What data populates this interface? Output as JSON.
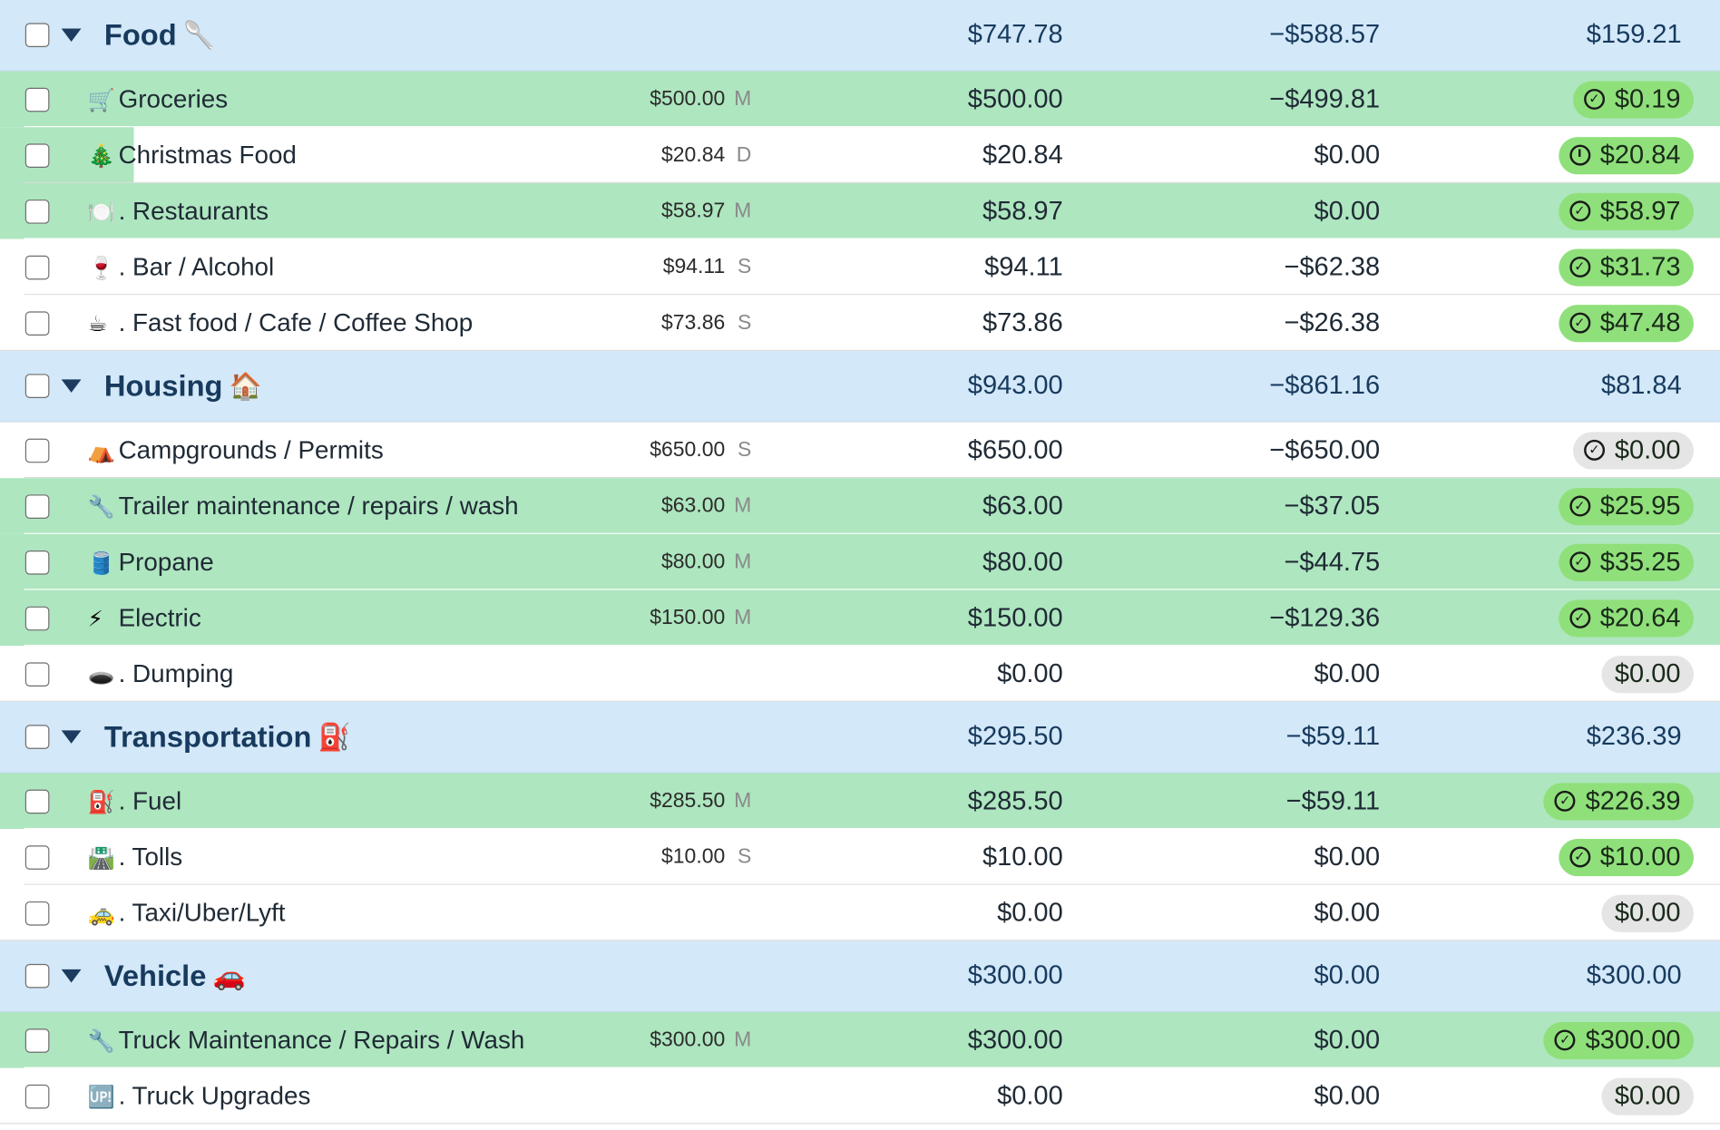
{
  "groups": [
    {
      "name": "Food",
      "emoji": "🥄",
      "assigned": "$747.78",
      "activity": "−$588.57",
      "available": "$159.21",
      "items": [
        {
          "emoji": "🛒",
          "name": "Groceries",
          "target": "$500.00",
          "code": "M",
          "assigned": "$500.00",
          "activity": "−$499.81",
          "available": "$0.19",
          "status": "check",
          "color": "green",
          "row": "funded"
        },
        {
          "emoji": "🎄",
          "name": "Christmas Food",
          "target": "$20.84",
          "code": "D",
          "assigned": "$20.84",
          "activity": "$0.00",
          "available": "$20.84",
          "status": "clock",
          "color": "green",
          "row": "partial"
        },
        {
          "emoji": "🍽️",
          "name": ". Restaurants",
          "target": "$58.97",
          "code": "M",
          "assigned": "$58.97",
          "activity": "$0.00",
          "available": "$58.97",
          "status": "check",
          "color": "green",
          "row": "funded"
        },
        {
          "emoji": "🍷",
          "name": ". Bar / Alcohol",
          "target": "$94.11",
          "code": "S",
          "assigned": "$94.11",
          "activity": "−$62.38",
          "available": "$31.73",
          "status": "check",
          "color": "green",
          "row": "plain"
        },
        {
          "emoji": "☕",
          "name": ". Fast food / Cafe / Coffee Shop",
          "target": "$73.86",
          "code": "S",
          "assigned": "$73.86",
          "activity": "−$26.38",
          "available": "$47.48",
          "status": "check",
          "color": "green",
          "row": "plain"
        }
      ]
    },
    {
      "name": "Housing",
      "emoji": "🏠",
      "assigned": "$943.00",
      "activity": "−$861.16",
      "available": "$81.84",
      "items": [
        {
          "emoji": "⛺",
          "name": "Campgrounds / Permits",
          "target": "$650.00",
          "code": "S",
          "assigned": "$650.00",
          "activity": "−$650.00",
          "available": "$0.00",
          "status": "check",
          "color": "grey",
          "row": "plain"
        },
        {
          "emoji": "🔧",
          "name": "Trailer maintenance / repairs / wash",
          "target": "$63.00",
          "code": "M",
          "assigned": "$63.00",
          "activity": "−$37.05",
          "available": "$25.95",
          "status": "check",
          "color": "green",
          "row": "funded"
        },
        {
          "emoji": "🛢️",
          "name": "Propane",
          "target": "$80.00",
          "code": "M",
          "assigned": "$80.00",
          "activity": "−$44.75",
          "available": "$35.25",
          "status": "check",
          "color": "green",
          "row": "funded"
        },
        {
          "emoji": "⚡",
          "name": "Electric",
          "target": "$150.00",
          "code": "M",
          "assigned": "$150.00",
          "activity": "−$129.36",
          "available": "$20.64",
          "status": "check",
          "color": "green",
          "row": "funded"
        },
        {
          "emoji": "🕳️",
          "name": ". Dumping",
          "target": "",
          "code": "",
          "assigned": "$0.00",
          "activity": "$0.00",
          "available": "$0.00",
          "status": "none",
          "color": "grey",
          "row": "plain"
        }
      ]
    },
    {
      "name": "Transportation",
      "emoji": "⛽",
      "assigned": "$295.50",
      "activity": "−$59.11",
      "available": "$236.39",
      "items": [
        {
          "emoji": "⛽",
          "name": ". Fuel",
          "target": "$285.50",
          "code": "M",
          "assigned": "$285.50",
          "activity": "−$59.11",
          "available": "$226.39",
          "status": "check",
          "color": "green",
          "row": "funded"
        },
        {
          "emoji": "🛣️",
          "name": ". Tolls",
          "target": "$10.00",
          "code": "S",
          "assigned": "$10.00",
          "activity": "$0.00",
          "available": "$10.00",
          "status": "check",
          "color": "green",
          "row": "plain"
        },
        {
          "emoji": "🚕",
          "name": ". Taxi/Uber/Lyft",
          "target": "",
          "code": "",
          "assigned": "$0.00",
          "activity": "$0.00",
          "available": "$0.00",
          "status": "none",
          "color": "grey",
          "row": "plain"
        }
      ]
    },
    {
      "name": "Vehicle",
      "emoji": "🚗",
      "assigned": "$300.00",
      "activity": "$0.00",
      "available": "$300.00",
      "items": [
        {
          "emoji": "🔧",
          "name": "Truck Maintenance / Repairs / Wash",
          "target": "$300.00",
          "code": "M",
          "assigned": "$300.00",
          "activity": "$0.00",
          "available": "$300.00",
          "status": "check",
          "color": "green",
          "row": "funded"
        },
        {
          "emoji": "🆙",
          "name": ". Truck Upgrades",
          "target": "",
          "code": "",
          "assigned": "$0.00",
          "activity": "$0.00",
          "available": "$0.00",
          "status": "none",
          "color": "grey",
          "row": "plain"
        }
      ]
    }
  ],
  "colors": {
    "group_bg": "#d3e8f8",
    "funded_bg": "#aee6bf",
    "pill_green": "#8fe07a",
    "pill_grey": "#e5e5e5",
    "group_text": "#173a5e"
  }
}
